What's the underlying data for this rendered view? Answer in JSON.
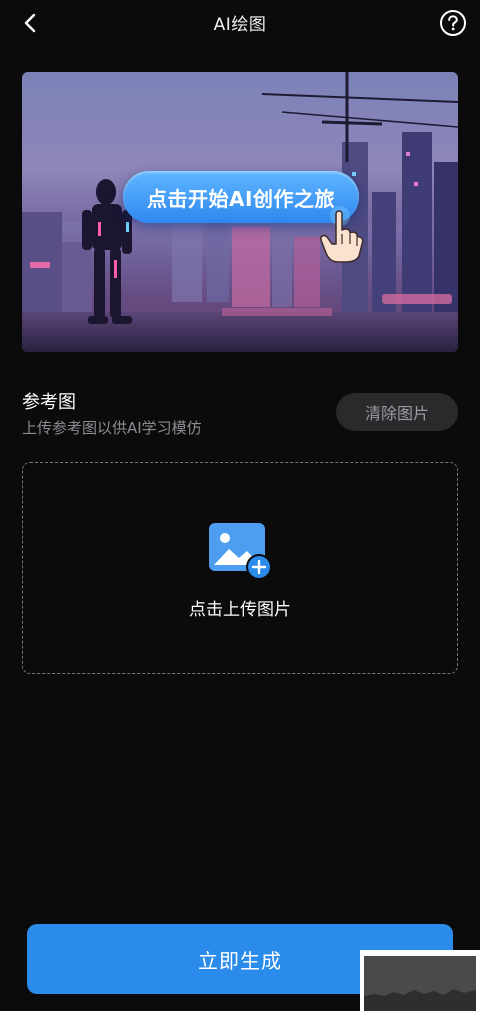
{
  "header": {
    "title": "AI绘图",
    "back_icon": "chevron-left-icon",
    "help_icon": "question-circle-icon"
  },
  "banner": {
    "cta_label": "点击开始AI创作之旅",
    "hand_icon": "pointing-hand-icon"
  },
  "reference": {
    "title": "参考图",
    "subtitle": "上传参考图以供AI学习模仿",
    "clear_label": "清除图片"
  },
  "upload": {
    "label": "点击上传图片",
    "icon": "image-add-icon"
  },
  "generate": {
    "label": "立即生成"
  },
  "colors": {
    "background": "#0b0b0c",
    "accent": "#2a8bea",
    "muted_text": "#8c8c92",
    "chip_bg": "#2a2a2c"
  }
}
